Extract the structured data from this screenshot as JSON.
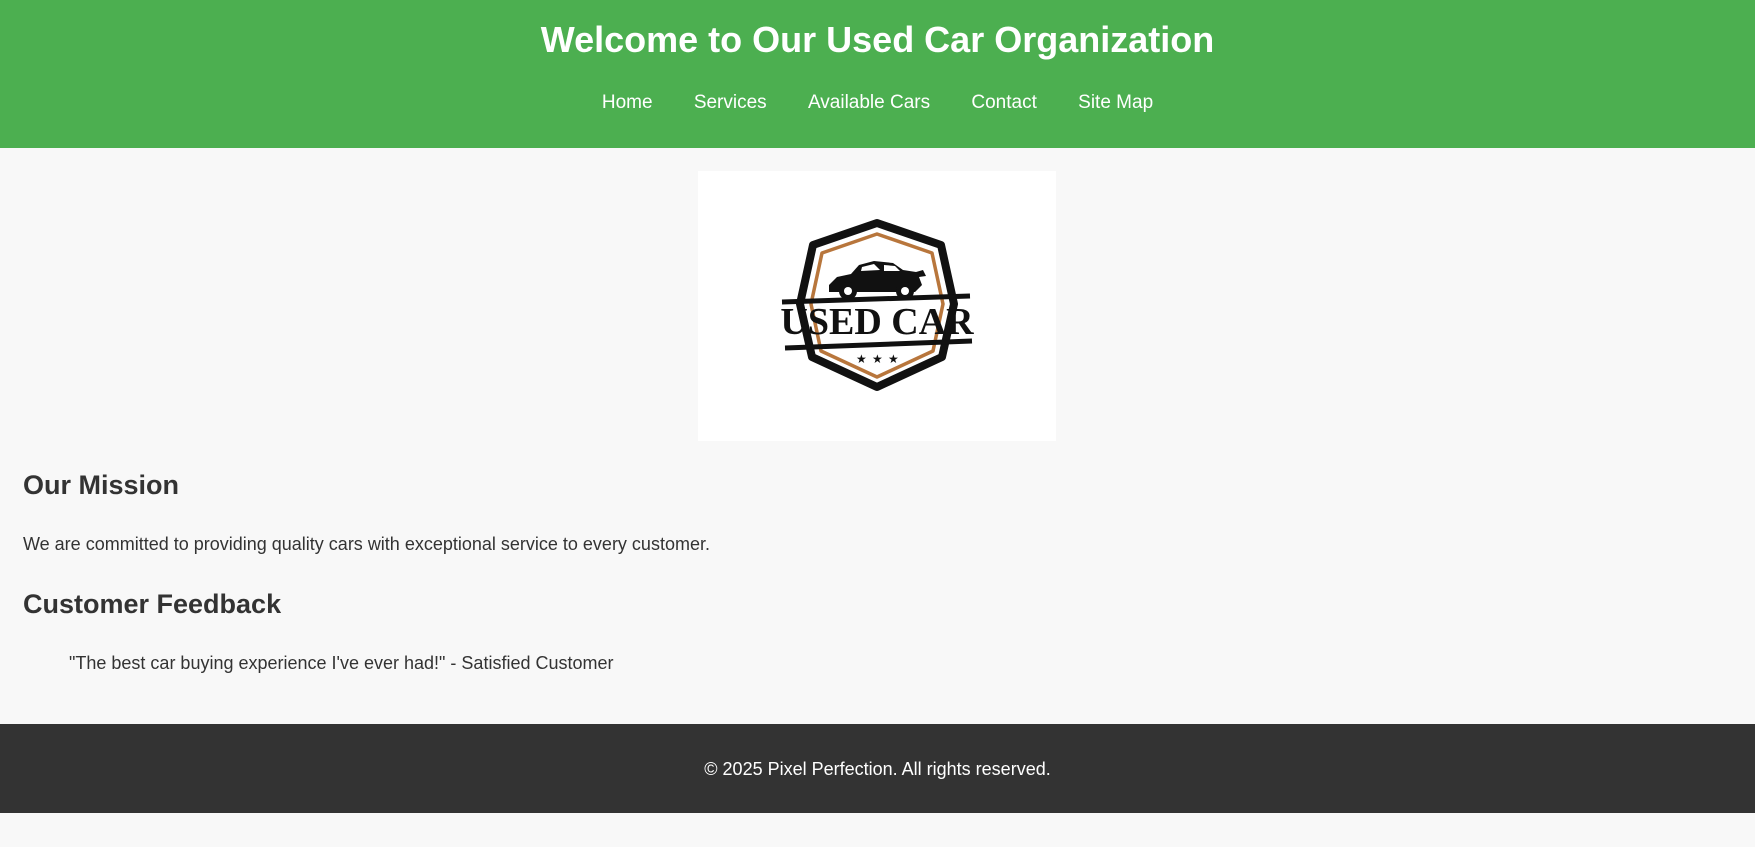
{
  "header": {
    "title": "Welcome to Our Used Car Organization",
    "nav": [
      {
        "label": "Home"
      },
      {
        "label": "Services"
      },
      {
        "label": "Available Cars"
      },
      {
        "label": "Contact"
      },
      {
        "label": "Site Map"
      }
    ]
  },
  "logo": {
    "text": "USED CAR",
    "icon": "car-emblem-icon"
  },
  "mission": {
    "heading": "Our Mission",
    "text": "We are committed to providing quality cars with exceptional service to every customer."
  },
  "feedback": {
    "heading": "Customer Feedback",
    "quote": "\"The best car buying experience I've ever had!\" - Satisfied Customer"
  },
  "footer": {
    "copyright": "© 2025 Pixel Perfection. All rights reserved."
  },
  "colors": {
    "header_bg": "#4caf50",
    "footer_bg": "#333333",
    "page_bg": "#f8f8f8",
    "text": "#333333"
  }
}
